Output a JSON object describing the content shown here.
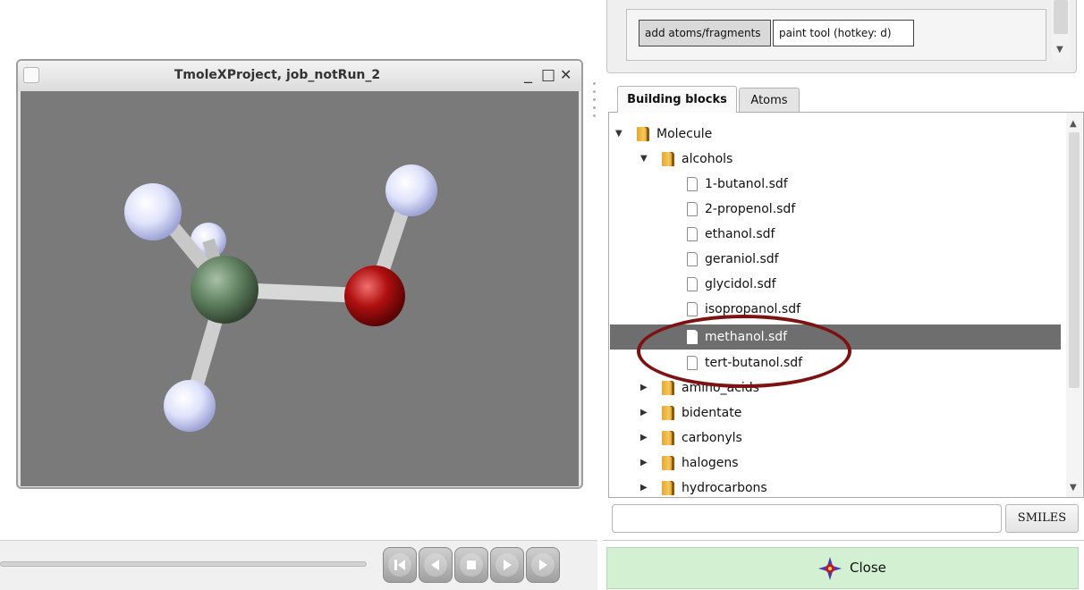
{
  "viewer": {
    "title": "TmoleXProject, job_notRun_2",
    "controls": {
      "minimize": "_",
      "maximize": "□",
      "close": "✕"
    },
    "viewport_bg": "#7a7a7a",
    "atom_colors": {
      "hydrogen": "#dfe3fb",
      "carbon": "#5f7f5f",
      "oxygen": "#b01010"
    }
  },
  "toolbar": {
    "add_atoms_label": "add atoms/fragments",
    "paint_tool_label": "paint tool (hotkey: d)"
  },
  "tabs": [
    {
      "label": "Building blocks",
      "selected": true
    },
    {
      "label": "Atoms",
      "selected": false
    }
  ],
  "tree": {
    "items": [
      {
        "label": "Molecule",
        "type": "folder",
        "expanded": true,
        "level": 0
      },
      {
        "label": "alcohols",
        "type": "folder",
        "expanded": true,
        "level": 1
      },
      {
        "label": "1-butanol.sdf",
        "type": "file",
        "level": 2
      },
      {
        "label": "2-propenol.sdf",
        "type": "file",
        "level": 2
      },
      {
        "label": "ethanol.sdf",
        "type": "file",
        "level": 2
      },
      {
        "label": "geraniol.sdf",
        "type": "file",
        "level": 2
      },
      {
        "label": "glycidol.sdf",
        "type": "file",
        "level": 2
      },
      {
        "label": "isopropanol.sdf",
        "type": "file",
        "level": 2
      },
      {
        "label": "methanol.sdf",
        "type": "file",
        "level": 2,
        "selected": true
      },
      {
        "label": "tert-butanol.sdf",
        "type": "file",
        "level": 2
      },
      {
        "label": "amino_acids",
        "type": "folder",
        "expanded": false,
        "level": 1
      },
      {
        "label": "bidentate",
        "type": "folder",
        "expanded": false,
        "level": 1
      },
      {
        "label": "carbonyls",
        "type": "folder",
        "expanded": false,
        "level": 1
      },
      {
        "label": "halogens",
        "type": "folder",
        "expanded": false,
        "level": 1
      },
      {
        "label": "hydrocarbons",
        "type": "folder",
        "expanded": false,
        "level": 1
      }
    ],
    "highlight_color": "#7c1313"
  },
  "smiles": {
    "input_value": "",
    "button_label": "SMILES"
  },
  "close_button": {
    "label": "Close",
    "bg": "#d3f1d2"
  },
  "playback": {
    "slider_value": 0
  }
}
